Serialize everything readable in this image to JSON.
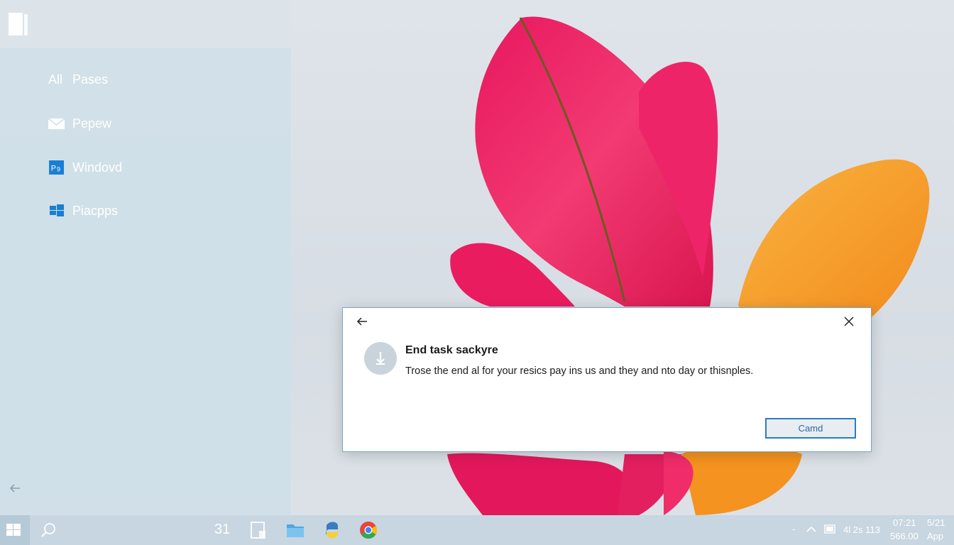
{
  "sidebar": {
    "items": [
      {
        "prefix": "All",
        "label": "Pases",
        "icon": "none"
      },
      {
        "label": "Pepew",
        "icon": "mail-icon"
      },
      {
        "label": "Windovd",
        "icon": "ps-app-icon"
      },
      {
        "label": "Piacpps",
        "icon": "windows-app-icon"
      }
    ]
  },
  "dialog": {
    "title": "End task sackyre",
    "message": "Trose the end al for your resics pay ins us and they and nto day or thisnples.",
    "button_label": "Camd"
  },
  "taskbar": {
    "pinned_label": "31",
    "tray": {
      "status": "4l 2s 113",
      "time_top": "07:21",
      "time_bottom": "566.00",
      "date_top": "5/21",
      "date_bottom": "App",
      "dash": "-"
    }
  },
  "colors": {
    "accent": "#2b7cc0",
    "petal_pink": "#f0246a",
    "petal_orange": "#f7a02a"
  }
}
